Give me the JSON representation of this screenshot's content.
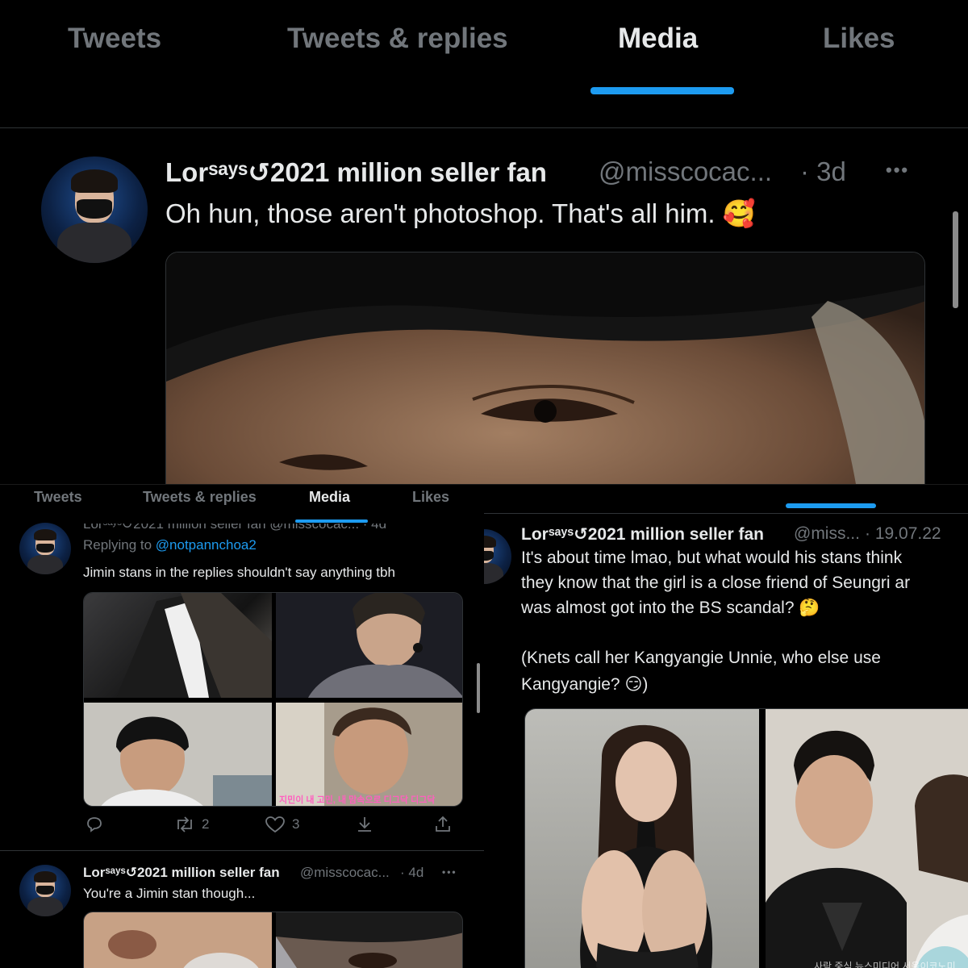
{
  "top_panel": {
    "tabs": [
      "Tweets",
      "Tweets & replies",
      "Media",
      "Likes"
    ],
    "active_tab": "Media",
    "tweet": {
      "name": "Lorˢᵃʸˢ↺2021 million seller fan",
      "handle": "@misscocac...",
      "time": "· 3d",
      "text": "Oh hun, those aren't photoshop. That's all him. 🥰",
      "more": "•••"
    }
  },
  "left_panel": {
    "tabs": [
      "Tweets",
      "Tweets & replies",
      "Media",
      "Likes"
    ],
    "active_tab": "Media",
    "partial_header": "Lorˢᵃʸˢ↺2021 million seller fan @misscocac... · 4d",
    "tweet1": {
      "replying_prefix": "Replying to",
      "replying_to": "@notpannchoa2",
      "text": "Jimin stans in the replies shouldn't say anything tbh",
      "image_caption": "지민이 내 고민, 내 맘속으로 디그닥 디그닥",
      "actions": {
        "reply_count": "",
        "retweet_count": "2",
        "like_count": "3"
      }
    },
    "tweet2": {
      "name": "Lorˢᵃʸˢ↺2021 million seller fan",
      "handle": "@misscocac...",
      "time": "· 4d",
      "text": "You're a Jimin stan though...",
      "more": "•••"
    }
  },
  "right_panel": {
    "tweet": {
      "name": "Lorˢᵃʸˢ↺2021 million seller fan",
      "handle": "@miss...",
      "time": "· 19.07.22",
      "line1": "It's about time lmao, but what would his stans think",
      "line2": "they know that the girl is a close friend of Seungri ar",
      "line3": "was almost got into the BS scandal? 🤔",
      "line4": "(Knets call her Kangyangie Unnie, who else use",
      "line5": "Kangyangie? 😏)",
      "image_watermark": "사람 중심 뉴스미디어 서울이코노미"
    }
  },
  "colors": {
    "accent": "#1d9bf0",
    "background": "#000000",
    "text": "#e7e9ea",
    "muted": "#71767b"
  }
}
